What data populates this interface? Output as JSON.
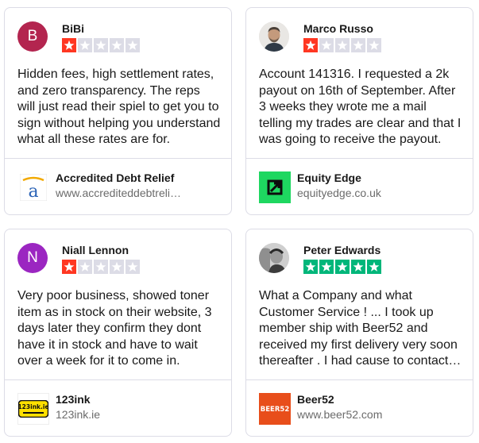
{
  "colors": {
    "star_one": "#ff3722",
    "star_five": "#00b67a",
    "star_empty": "#dcdce6",
    "border": "#dcdce6",
    "url_gray": "#6b6b6b"
  },
  "reviews": [
    {
      "reviewer": {
        "name": "BiBi",
        "initial": "B",
        "avatar_color": "#b3254f",
        "avatar_type": "initial"
      },
      "rating": 1,
      "text": "Hidden fees, high settlement rates, and zero transparency. The reps will just read their spiel to get you to sign without helping you understand what all these rates are for.",
      "business": {
        "name": "Accredited Debt Relief",
        "url": "www.accrediteddebtrelief.com",
        "logo_icon": "accredited-a-logo-icon"
      }
    },
    {
      "reviewer": {
        "name": "Marco Russo",
        "initial": "",
        "avatar_type": "photo"
      },
      "rating": 1,
      "text": "Account 141316. I requested a 2k payout on 16th of September. After 3 weeks they wrote me a mail telling my trades are clear and that I was going to receive the payout.",
      "business": {
        "name": "Equity Edge",
        "url": "equityedge.co.uk",
        "logo_icon": "equity-edge-logo-icon"
      }
    },
    {
      "reviewer": {
        "name": "Niall Lennon",
        "initial": "N",
        "avatar_color": "#9b26c1",
        "avatar_type": "initial"
      },
      "rating": 1,
      "text": "Very poor business, showed toner item as in stock on their website, 3 days later they confirm they dont have it in stock and have to wait over a week for it to come in.",
      "business": {
        "name": "123ink",
        "url": "123ink.ie",
        "logo_icon": "123ink-logo-icon",
        "logo_text": "123ink.ie"
      }
    },
    {
      "reviewer": {
        "name": "Peter Edwards",
        "initial": "",
        "avatar_type": "photo"
      },
      "rating": 5,
      "text": "What a Company and what Customer Service ! ... I took up member ship with Beer52 and received my first delivery very soon thereafter . I had cause to contact them.",
      "business": {
        "name": "Beer52",
        "url": "www.beer52.com",
        "logo_icon": "beer52-logo-icon",
        "logo_text": "BEER52"
      }
    }
  ]
}
